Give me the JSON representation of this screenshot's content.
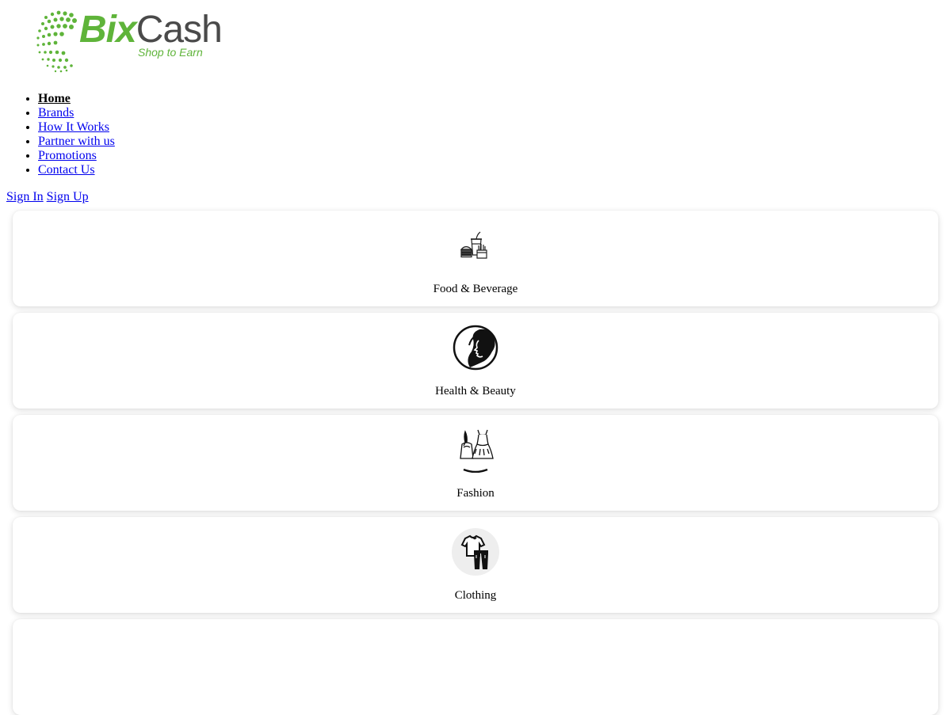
{
  "logo": {
    "word_part1": "Bix",
    "word_part2": "Cash",
    "tagline": "Shop to Earn",
    "brand_green": "#5fb43a",
    "brand_gray": "#4a4a4a"
  },
  "nav": {
    "items": [
      {
        "label": "Home",
        "active": true
      },
      {
        "label": "Brands"
      },
      {
        "label": "How It Works"
      },
      {
        "label": "Partner with us"
      },
      {
        "label": "Promotions"
      },
      {
        "label": "Contact Us"
      }
    ]
  },
  "auth": {
    "sign_in": "Sign In",
    "sign_up": "Sign Up"
  },
  "categories": [
    {
      "label": "Food & Beverage",
      "icon": "food-beverage-icon"
    },
    {
      "label": "Health & Beauty",
      "icon": "health-beauty-icon"
    },
    {
      "label": "Fashion",
      "icon": "fashion-icon"
    },
    {
      "label": "Clothing",
      "icon": "clothing-icon"
    }
  ]
}
